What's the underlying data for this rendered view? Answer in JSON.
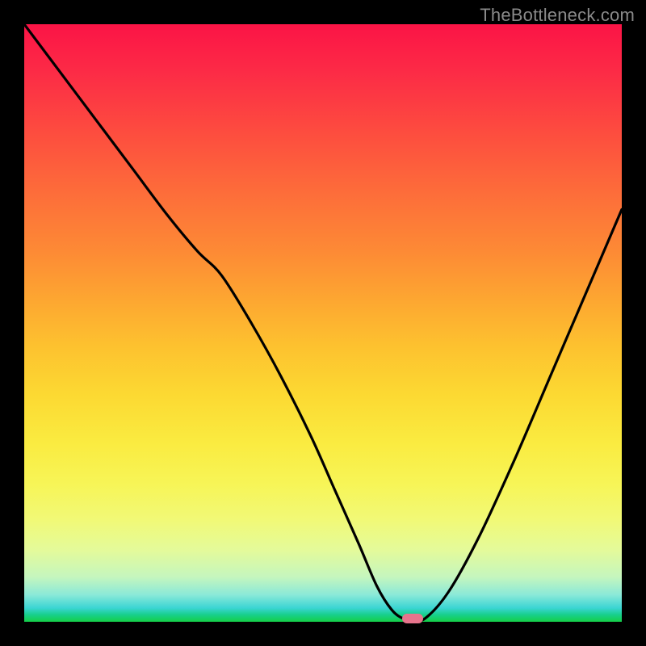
{
  "watermark": "TheBottleneck.com",
  "colors": {
    "frame": "#000000",
    "curve": "#000000",
    "marker": "#e7748c",
    "gradient_top": "#fb1446",
    "gradient_bottom": "#15cf47"
  },
  "chart_data": {
    "type": "line",
    "title": "",
    "xlabel": "",
    "ylabel": "",
    "xlim": [
      0,
      100
    ],
    "ylim": [
      0,
      100
    ],
    "grid": false,
    "legend": false,
    "description": "Bottleneck-style V-curve on rainbow background; y represents mismatch percentage (100 = full bottleneck / red, 0 = balanced / green). Minimum marked with pink pill.",
    "series": [
      {
        "name": "bottleneck-curve",
        "x": [
          0,
          6,
          12,
          18,
          24,
          29,
          33,
          38,
          43,
          48,
          52,
          56,
          59,
          61.5,
          63.5,
          65,
          67,
          71,
          76,
          82,
          88,
          94,
          100
        ],
        "y": [
          100,
          92,
          84,
          76,
          68,
          62,
          58,
          50,
          41,
          31,
          22,
          13,
          6,
          2,
          0.5,
          0.5,
          0.5,
          5,
          14,
          27,
          41,
          55,
          69
        ]
      }
    ],
    "marker": {
      "x": 65,
      "y": 0.5
    }
  }
}
